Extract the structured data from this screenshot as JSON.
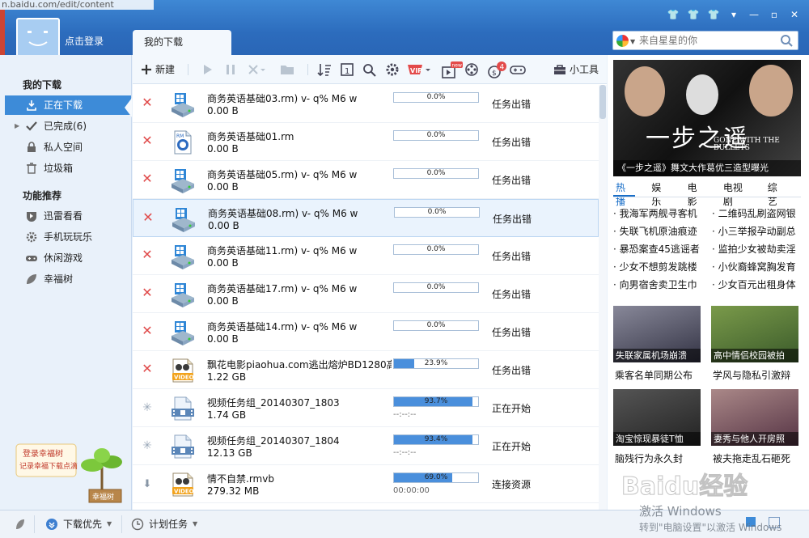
{
  "url_fragment": "n.baidu.com/edit/content",
  "header": {
    "login_text": "点击登录",
    "tab_label": "我的下载",
    "search_placeholder": "来自星星的你"
  },
  "sidebar": {
    "section1_title": "我的下载",
    "items1": [
      {
        "label": "正在下载",
        "icon": "download-icon"
      },
      {
        "label": "已完成(6)",
        "icon": "check-icon"
      },
      {
        "label": "私人空间",
        "icon": "lock-icon"
      },
      {
        "label": "垃圾箱",
        "icon": "trash-icon"
      }
    ],
    "section2_title": "功能推荐",
    "items2": [
      {
        "label": "迅雷看看",
        "icon": "play-shield-icon"
      },
      {
        "label": "手机玩玩乐",
        "icon": "gear-icon"
      },
      {
        "label": "休闲游戏",
        "icon": "gamepad-icon"
      },
      {
        "label": "幸福树",
        "icon": "leaf-icon"
      }
    ],
    "tree_promo_line1": "登录幸福树",
    "tree_promo_line2": "记录幸福下载点滴",
    "tree_label": "幸福树"
  },
  "toolbar": {
    "new_label": "新建",
    "tools_label": "小工具",
    "badge_count": "4",
    "new_badge": "new"
  },
  "downloads": [
    {
      "name": "商务英语基础03.rm) v- q% M6 w",
      "size": "0.00 B",
      "progress": 0.0,
      "progress_text": "0.0%",
      "status": "任务出错",
      "state": "error",
      "icon": "install-package-icon",
      "time": ""
    },
    {
      "name": "商务英语基础01.rm",
      "size": "0.00 B",
      "progress": 0.0,
      "progress_text": "0.0%",
      "status": "任务出错",
      "state": "error",
      "icon": "rm-file-icon",
      "time": ""
    },
    {
      "name": "商务英语基础05.rm) v- q% M6 w",
      "size": "0.00 B",
      "progress": 0.0,
      "progress_text": "0.0%",
      "status": "任务出错",
      "state": "error",
      "icon": "install-package-icon",
      "time": ""
    },
    {
      "name": "商务英语基础08.rm) v- q% M6 w",
      "size": "0.00 B",
      "progress": 0.0,
      "progress_text": "0.0%",
      "status": "任务出错",
      "state": "error",
      "icon": "install-package-icon",
      "time": "",
      "selected": true
    },
    {
      "name": "商务英语基础11.rm) v- q% M6 w",
      "size": "0.00 B",
      "progress": 0.0,
      "progress_text": "0.0%",
      "status": "任务出错",
      "state": "error",
      "icon": "install-package-icon",
      "time": ""
    },
    {
      "name": "商务英语基础17.rm) v- q% M6 w",
      "size": "0.00 B",
      "progress": 0.0,
      "progress_text": "0.0%",
      "status": "任务出错",
      "state": "error",
      "icon": "install-package-icon",
      "time": ""
    },
    {
      "name": "商务英语基础14.rm) v- q% M6 w",
      "size": "0.00 B",
      "progress": 0.0,
      "progress_text": "0.0%",
      "status": "任务出错",
      "state": "error",
      "icon": "install-package-icon",
      "time": ""
    },
    {
      "name": "飘花电影piaohua.com逃出熔炉BD1280高...",
      "size": "1.22 GB",
      "progress": 23.9,
      "progress_text": "23.9%",
      "status": "任务出错",
      "state": "error",
      "icon": "video-file-icon",
      "time": ""
    },
    {
      "name": "视频任务组_20140307_1803",
      "size": "1.74 GB",
      "progress": 93.7,
      "progress_text": "93.7%",
      "status": "正在开始",
      "state": "starting",
      "icon": "video-group-icon",
      "time": "--:--:--"
    },
    {
      "name": "视频任务组_20140307_1804",
      "size": "12.13 GB",
      "progress": 93.4,
      "progress_text": "93.4%",
      "status": "正在开始",
      "state": "starting",
      "icon": "video-group-icon",
      "time": "--:--:--"
    },
    {
      "name": "情不自禁.rmvb",
      "size": "279.32 MB",
      "progress": 69.0,
      "progress_text": "69.0%",
      "status": "连接资源",
      "state": "connecting",
      "icon": "video-file-icon",
      "time": "00:00:00"
    }
  ],
  "right_panel": {
    "ad_title": "一步之遥",
    "ad_english": "GONE WITH THE BULLETS",
    "ad_caption": "《一步之遥》舞文大作葛优三造型曝光",
    "tabs": [
      "热播",
      "娱乐",
      "电影",
      "电视剧",
      "综艺"
    ],
    "news": [
      [
        "我海军两舰寻客机",
        "二维码乱刷盗网银"
      ],
      [
        "失联飞机原油痕迹",
        "小三举报孕动副总"
      ],
      [
        "暴恐案查45逃谣者",
        "监拍少女被劫卖淫"
      ],
      [
        "少女不想剪发跳楼",
        "小伙裔蜂窝胸发育"
      ],
      [
        "向男宿舍卖卫生巾",
        "少女百元出租身体"
      ]
    ],
    "thumbs": [
      {
        "caption": "失联家属机场崩溃",
        "label": "乘客名单同期公布"
      },
      {
        "caption": "高中情侣校园被拍",
        "label": "学风与隐私引激辩"
      },
      {
        "caption": "淘宝惊现暴徒T恤",
        "label": "脑残行为永久封"
      },
      {
        "caption": "妻秀与他人开房照",
        "label": "被夫拖走乱石砸死"
      }
    ]
  },
  "statusbar": {
    "priority_label": "下载优先",
    "schedule_label": "计划任务"
  },
  "watermark": {
    "brand": "Baidu经验",
    "activate": "激活 Windows",
    "activate_hint": "转到\"电脑设置\"以激活 Windows"
  },
  "colors": {
    "accent": "#3d8bd8",
    "error": "#e04a4a",
    "progress": "#4a8fdc"
  }
}
